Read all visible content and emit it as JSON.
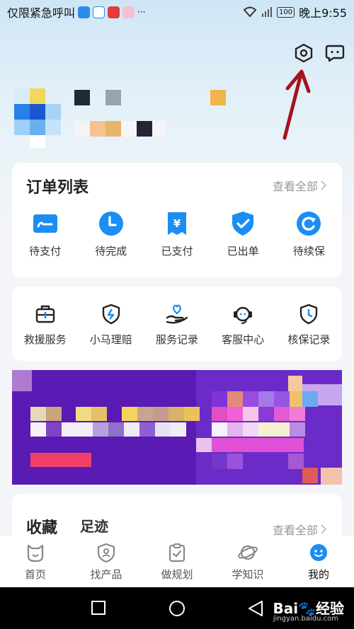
{
  "status_bar": {
    "notification_text": "仅限紧急呼叫",
    "battery": "100",
    "time": "晚上9:55",
    "more": "···"
  },
  "header": {
    "settings_icon": "settings-hex-icon",
    "message_icon": "chat-bubble-icon"
  },
  "orders": {
    "title": "订单列表",
    "view_all": "查看全部",
    "items": [
      {
        "label": "待支付",
        "icon": "wallet-icon"
      },
      {
        "label": "待完成",
        "icon": "clock-icon"
      },
      {
        "label": "已支付",
        "icon": "yen-doc-icon"
      },
      {
        "label": "已出单",
        "icon": "shield-check-icon"
      },
      {
        "label": "待续保",
        "icon": "refresh-icon"
      }
    ]
  },
  "services": {
    "items": [
      {
        "label": "救援服务",
        "icon": "first-aid-kit-icon"
      },
      {
        "label": "小马理赔",
        "icon": "shield-bolt-icon"
      },
      {
        "label": "服务记录",
        "icon": "hand-heart-icon"
      },
      {
        "label": "客服中心",
        "icon": "headset-icon"
      },
      {
        "label": "核保记录",
        "icon": "shield-clock-icon"
      }
    ]
  },
  "favorites": {
    "tab_favorites": "收藏",
    "tab_footprints": "足迹",
    "view_all": "查看全部"
  },
  "tabbar": {
    "items": [
      {
        "label": "首页",
        "icon": "home-face-icon"
      },
      {
        "label": "找产品",
        "icon": "product-shield-icon"
      },
      {
        "label": "做规划",
        "icon": "plan-clipboard-icon"
      },
      {
        "label": "学知识",
        "icon": "planet-icon"
      },
      {
        "label": "我的",
        "icon": "smile-icon",
        "active": true
      }
    ]
  },
  "watermark": {
    "brand": "Bai",
    "suffix": "经验",
    "url": "jingyan.baidu.com"
  },
  "colors": {
    "accent": "#1a8ef2",
    "arrow": "#a3141d",
    "banner": "#5a1ab4"
  }
}
